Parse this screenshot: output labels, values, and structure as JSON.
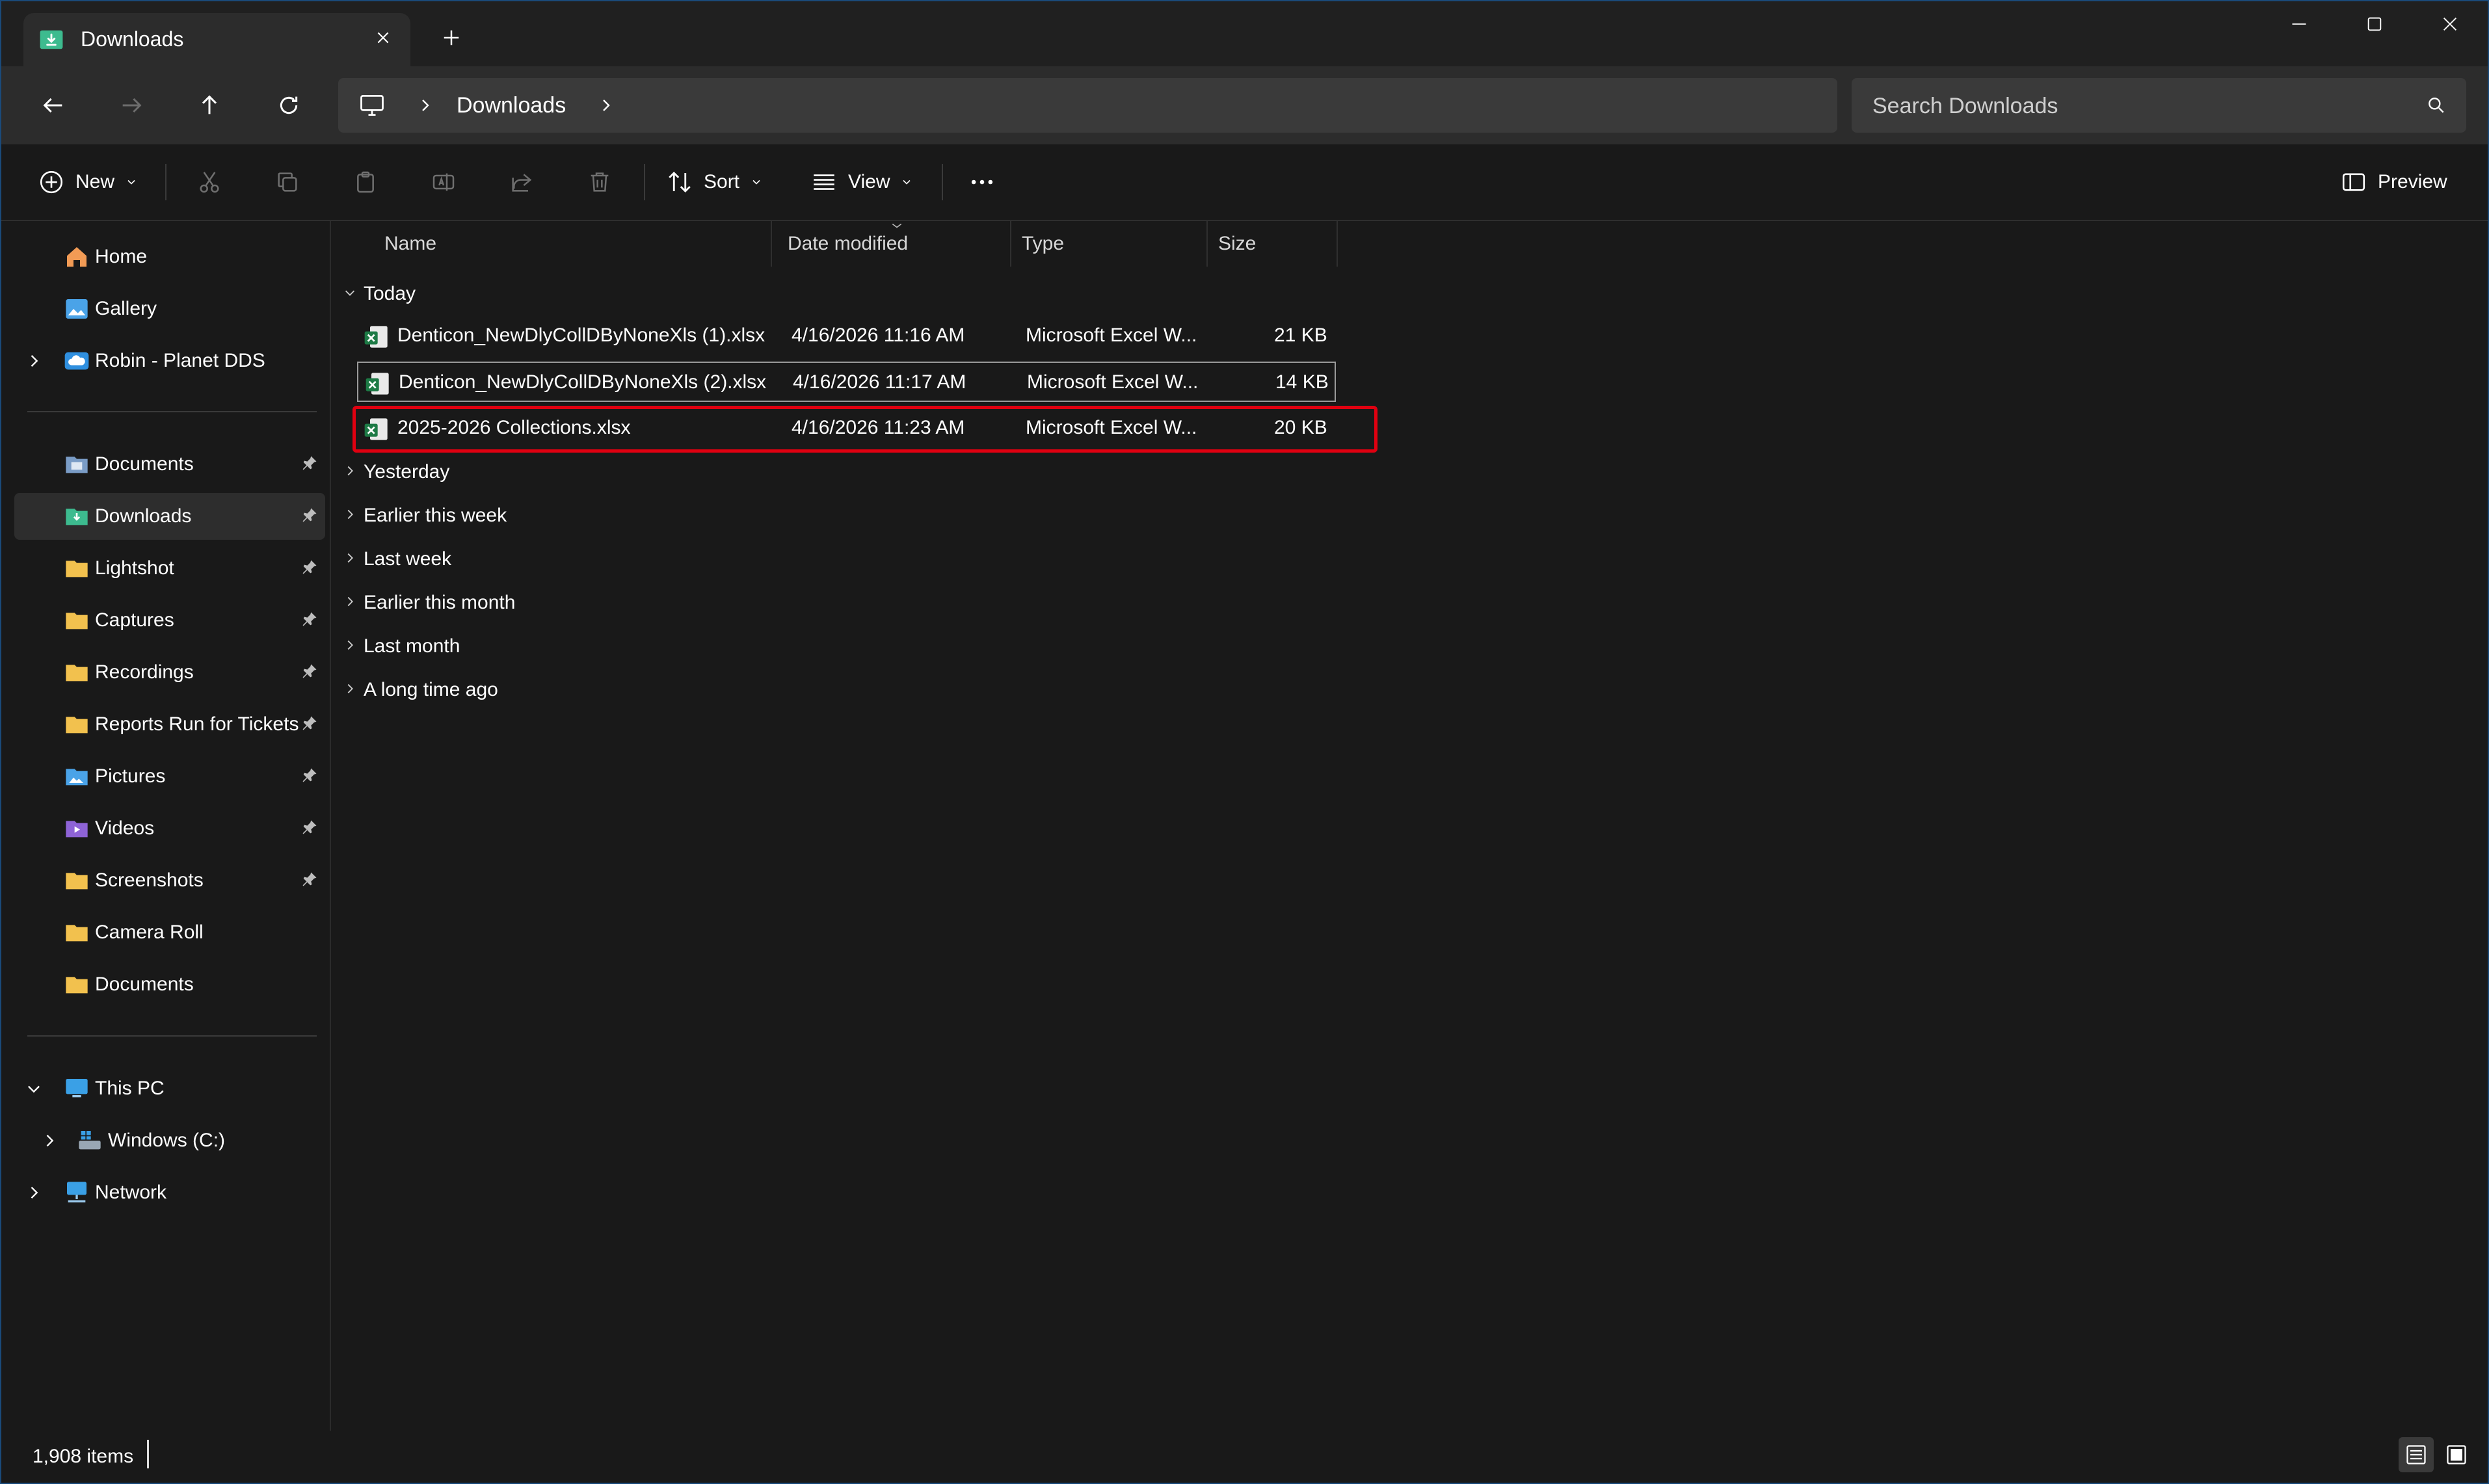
{
  "window": {
    "tab_title": "Downloads",
    "controls": [
      "minimize",
      "maximize",
      "close"
    ]
  },
  "address": {
    "breadcrumb": "Downloads",
    "search_placeholder": "Search Downloads"
  },
  "toolbar": {
    "new_label": "New",
    "sort_label": "Sort",
    "view_label": "View",
    "preview_label": "Preview",
    "icons": [
      "cut-icon",
      "copy-icon",
      "paste-icon",
      "rename-icon",
      "share-icon",
      "delete-icon",
      "more-icon"
    ]
  },
  "sidebar": {
    "top": [
      {
        "label": "Home",
        "icon": "home-icon"
      },
      {
        "label": "Gallery",
        "icon": "gallery-icon"
      },
      {
        "label": "Robin - Planet DDS",
        "icon": "cloud-icon"
      }
    ],
    "quick_access": [
      {
        "label": "Documents",
        "icon": "documents-icon",
        "pinned": true
      },
      {
        "label": "Downloads",
        "icon": "downloads-icon",
        "pinned": true,
        "selected": true
      },
      {
        "label": "Lightshot",
        "icon": "folder-icon",
        "pinned": true
      },
      {
        "label": "Captures",
        "icon": "folder-icon",
        "pinned": true
      },
      {
        "label": "Recordings",
        "icon": "folder-icon",
        "pinned": true
      },
      {
        "label": "Reports Run for Tickets",
        "icon": "folder-icon",
        "pinned": true
      },
      {
        "label": "Pictures",
        "icon": "pictures-icon",
        "pinned": true
      },
      {
        "label": "Videos",
        "icon": "videos-icon",
        "pinned": true
      },
      {
        "label": "Screenshots",
        "icon": "folder-icon",
        "pinned": true
      },
      {
        "label": "Camera Roll",
        "icon": "folder-icon",
        "pinned": false
      },
      {
        "label": "Documents",
        "icon": "folder-icon",
        "pinned": false
      }
    ],
    "devices": [
      {
        "label": "This PC",
        "icon": "pc-icon"
      },
      {
        "label": "Windows (C:)",
        "icon": "drive-icon"
      },
      {
        "label": "Network",
        "icon": "network-icon"
      }
    ]
  },
  "columns": {
    "name": "Name",
    "date": "Date modified",
    "type": "Type",
    "size": "Size"
  },
  "groups": {
    "today": "Today",
    "collapsed": [
      "Yesterday",
      "Earlier this week",
      "Last week",
      "Earlier this month",
      "Last month",
      "A long time ago"
    ]
  },
  "files": [
    {
      "name": "Denticon_NewDlyCollDByNoneXls (1).xlsx",
      "date": "4/16/2026 11:16 AM",
      "type": "Microsoft Excel W...",
      "size": "21 KB"
    },
    {
      "name": "Denticon_NewDlyCollDByNoneXls (2).xlsx",
      "date": "4/16/2026 11:17 AM",
      "type": "Microsoft Excel W...",
      "size": "14 KB"
    },
    {
      "name": "2025-2026 Collections.xlsx",
      "date": "4/16/2026 11:23 AM",
      "type": "Microsoft Excel W...",
      "size": "20 KB"
    }
  ],
  "status": {
    "item_count": "1,908 items"
  },
  "colors": {
    "background": "#191919",
    "accent": "#4cc2ff",
    "highlight": "#e00010",
    "folder": "#f2c14e",
    "excel": "#1d7a45"
  }
}
